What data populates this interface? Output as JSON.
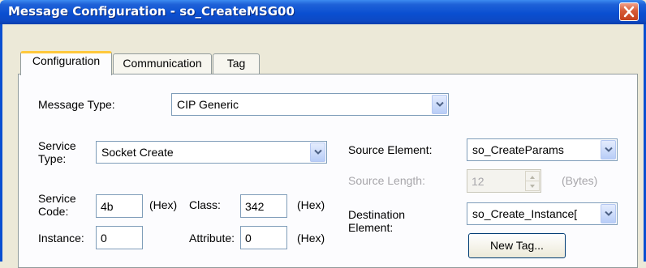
{
  "window": {
    "title": "Message Configuration - so_CreateMSG00"
  },
  "tabs": [
    {
      "label": "Configuration",
      "active": true
    },
    {
      "label": "Communication",
      "active": false
    },
    {
      "label": "Tag",
      "active": false
    }
  ],
  "form": {
    "message_type_label": "Message Type:",
    "message_type_value": "CIP Generic",
    "service_type_label": "Service\nType:",
    "service_type_value": "Socket Create",
    "service_code_label": "Service\nCode:",
    "service_code_value": "4b",
    "hex_label_1": "(Hex)",
    "class_label": "Class:",
    "class_value": "342",
    "hex_label_2": "(Hex)",
    "instance_label": "Instance:",
    "instance_value": "0",
    "attribute_label": "Attribute:",
    "attribute_value": "0",
    "hex_label_3": "(Hex)",
    "source_element_label": "Source Element:",
    "source_element_value": "so_CreateParams",
    "source_length_label": "Source Length:",
    "source_length_value": "12",
    "bytes_label": "(Bytes)",
    "destination_element_label": "Destination\nElement:",
    "destination_element_value": "so_Create_Instance[",
    "new_tag_button": "New Tag..."
  },
  "colors": {
    "titlebar": "#0a4fd1",
    "dialog_bg": "#ece9d8",
    "active_tab_accent": "#ffc83c",
    "close_button": "#d65a36"
  }
}
